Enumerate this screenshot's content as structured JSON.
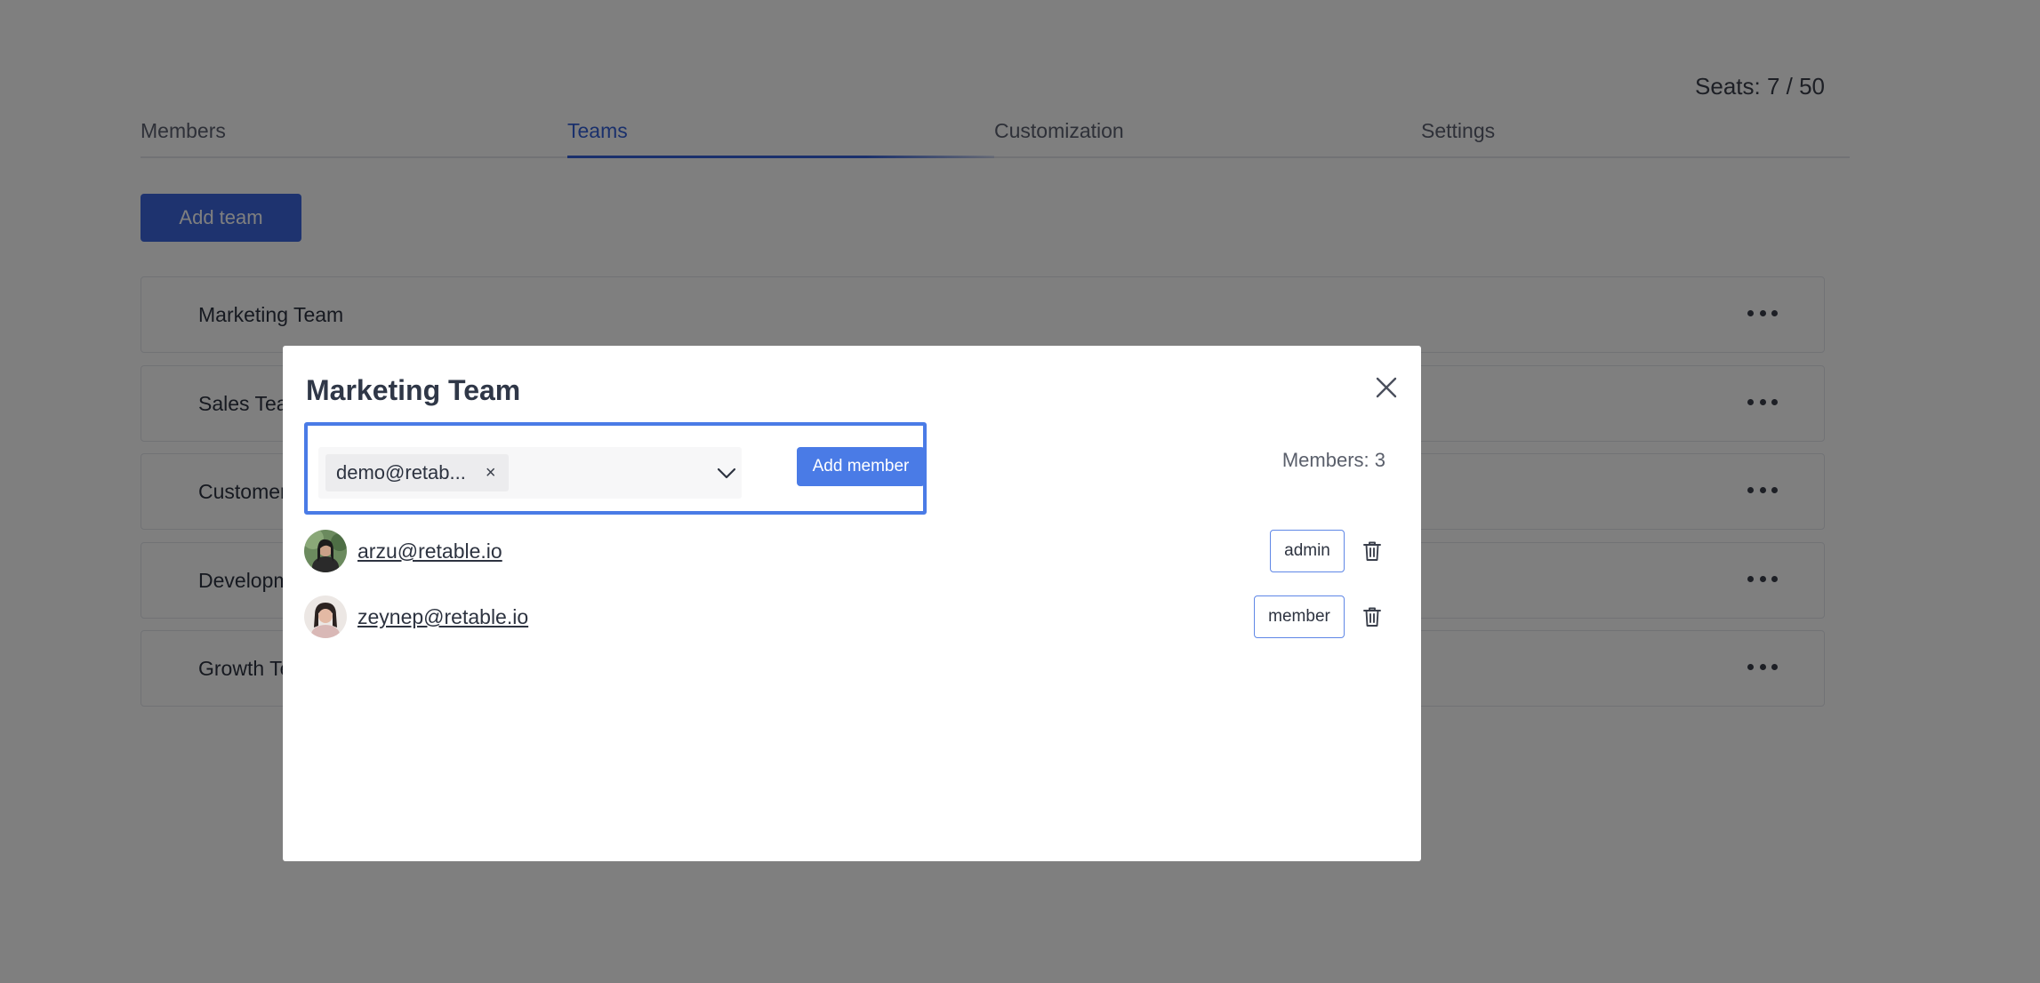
{
  "header": {
    "seats_label": "Seats: 7 / 50"
  },
  "tabs": [
    {
      "label": "Members"
    },
    {
      "label": "Teams",
      "active": true
    },
    {
      "label": "Customization"
    },
    {
      "label": "Settings"
    }
  ],
  "toolbar": {
    "add_team_label": "Add team"
  },
  "teams": [
    {
      "name": "Marketing Team"
    },
    {
      "name": "Sales Team"
    },
    {
      "name": "Customer Success"
    },
    {
      "name": "Development"
    },
    {
      "name": "Growth Team"
    }
  ],
  "modal": {
    "title": "Marketing Team",
    "selected_chip": "demo@retab...",
    "chip_remove": "×",
    "add_member_label": "Add member",
    "members_count": "Members: 3",
    "members": [
      {
        "email": "arzu@retable.io",
        "role": "admin"
      },
      {
        "email": "zeynep@retable.io",
        "role": "member"
      }
    ]
  },
  "colors": {
    "accent": "#4a7be6",
    "primary_button": "#3d67df",
    "active_tab": "#3461d8",
    "overlay": "rgba(0,0,0,0.5)"
  },
  "icons": {
    "close": "close-icon",
    "dropdown": "chevron-down-icon",
    "delete": "trash-icon",
    "more": "more-horizontal-icon"
  }
}
